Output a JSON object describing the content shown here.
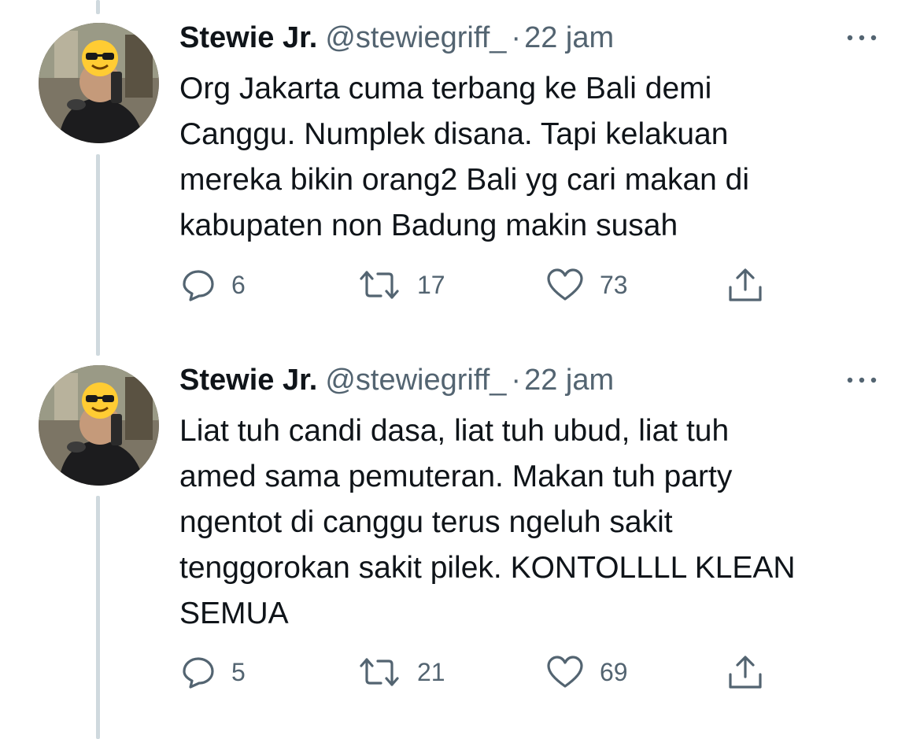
{
  "tweets": [
    {
      "display_name": "Stewie Jr.",
      "handle": "@stewiegriff_",
      "separator": "·",
      "time": "22 jam",
      "lines": [
        "Org Jakarta cuma terbang ke Bali demi",
        "Canggu. Numplek disana. Tapi kelakuan",
        "mereka bikin orang2 Bali yg cari makan di",
        "kabupaten non Badung makin susah"
      ],
      "replies": "6",
      "retweets": "17",
      "likes": "73"
    },
    {
      "display_name": "Stewie Jr.",
      "handle": "@stewiegriff_",
      "separator": "·",
      "time": "22 jam",
      "lines": [
        "Liat tuh candi dasa, liat tuh ubud, liat tuh",
        "amed sama pemuteran. Makan tuh party",
        "ngentot di canggu terus ngeluh sakit",
        "tenggorokan sakit pilek. KONTOLLLL KLEAN",
        "SEMUA"
      ],
      "replies": "5",
      "retweets": "21",
      "likes": "69"
    }
  ],
  "icons": {
    "reply": "speech-bubble-icon",
    "retweet": "retweet-arrows-icon",
    "like": "heart-outline-icon",
    "share": "share-upload-icon",
    "more": "more-dots-icon",
    "avatar_overlay": "sunglasses-emoji-icon"
  },
  "colors": {
    "text": "#0f1419",
    "secondary": "#536471",
    "thread_line": "#cfd9de",
    "emoji": "#ffcc33"
  }
}
